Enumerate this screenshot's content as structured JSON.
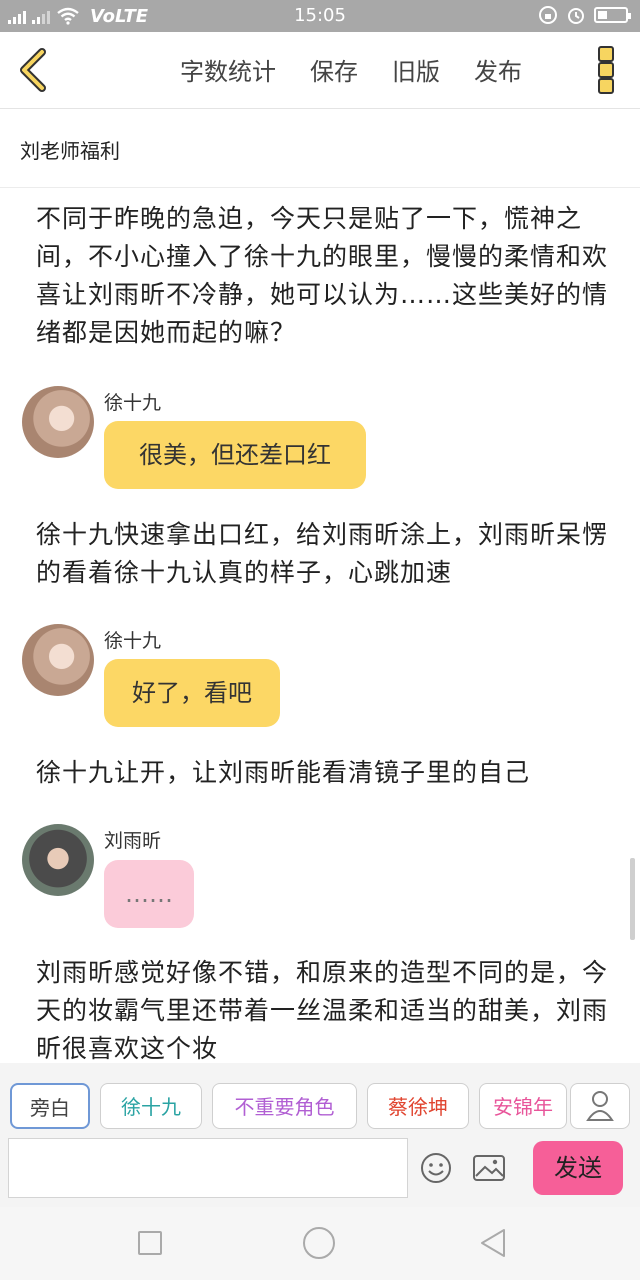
{
  "status_bar": {
    "signal_tag": "4G",
    "network_tag": "HD",
    "volte": "VoLTE",
    "time": "15:05"
  },
  "header": {
    "back_icon": "chevron-left-icon",
    "menu": [
      "字数统计",
      "保存",
      "旧版",
      "发布"
    ],
    "more_icon": "vertical-dots-icon"
  },
  "title": "刘老师福利",
  "story": {
    "narration_1": "不同于昨晚的急迫，今天只是贴了一下，慌神之间，不小心撞入了徐十九的眼里，慢慢的柔情和欢喜让刘雨昕不冷静，她可以认为……这些美好的情绪都是因她而起的嘛？",
    "msg_1": {
      "speaker": "徐十九",
      "text": "很美，但还差口红"
    },
    "narration_2": "徐十九快速拿出口红，给刘雨昕涂上，刘雨昕呆愣的看着徐十九认真的样子，心跳加速",
    "msg_2": {
      "speaker": "徐十九",
      "text": "好了，看吧"
    },
    "narration_3": "徐十九让开，让刘雨昕能看清镜子里的自己",
    "msg_3": {
      "speaker": "刘雨昕",
      "text": "……"
    },
    "narration_4": "刘雨昕感觉好像不错，和原来的造型不同的是，今天的妆霸气里还带着一丝温柔和适当的甜美，刘雨昕很喜欢这个妆"
  },
  "roles": [
    {
      "label": "旁白",
      "color": "#444444"
    },
    {
      "label": "徐十九",
      "color": "#2aa3a3"
    },
    {
      "label": "不重要角色",
      "color": "#b15fd3"
    },
    {
      "label": "蔡徐坤",
      "color": "#e0442f"
    },
    {
      "label": "安锦年",
      "color": "#e8559a"
    }
  ],
  "input": {
    "placeholder": "",
    "send_label": "发送"
  },
  "colors": {
    "bubble_yellow": "#fcd765",
    "bubble_pink": "#fbcbd9",
    "send": "#f65f98",
    "accent": "#f7d560"
  }
}
